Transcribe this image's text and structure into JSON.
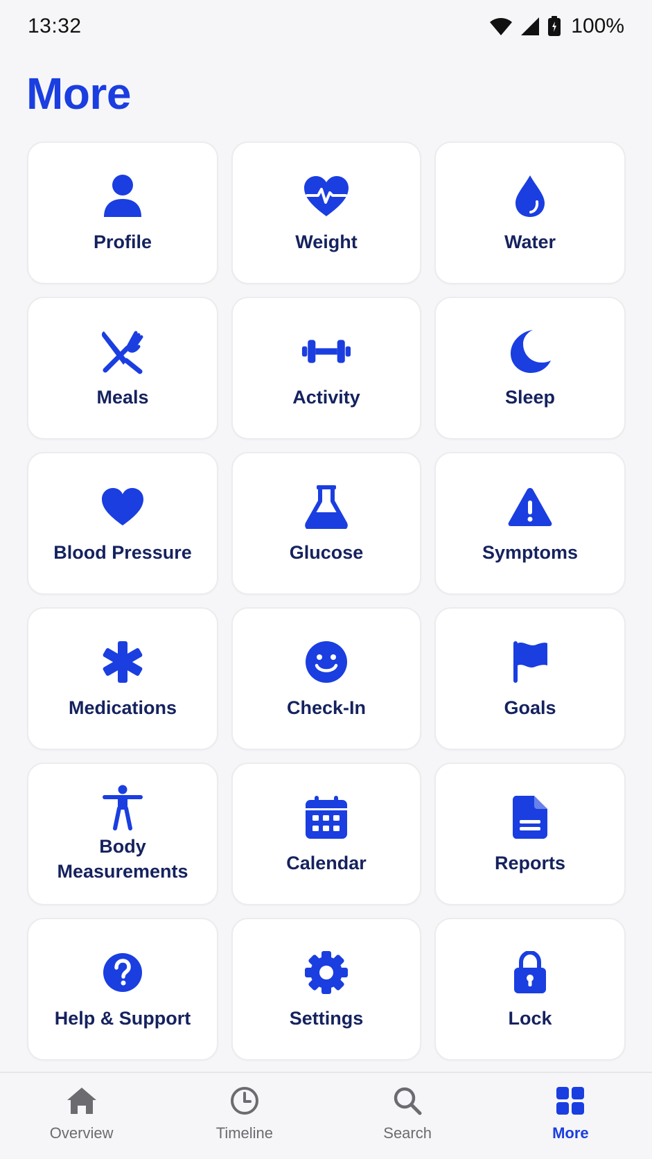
{
  "status_bar": {
    "time": "13:32",
    "battery": "100%"
  },
  "page": {
    "title": "More"
  },
  "accent_color": "#1a3ee0",
  "label_color": "#15225e",
  "tiles": [
    {
      "label": "Profile",
      "icon": "person-icon"
    },
    {
      "label": "Weight",
      "icon": "heart-pulse-icon"
    },
    {
      "label": "Water",
      "icon": "water-drop-icon"
    },
    {
      "label": "Meals",
      "icon": "fork-knife-icon"
    },
    {
      "label": "Activity",
      "icon": "dumbbell-icon"
    },
    {
      "label": "Sleep",
      "icon": "moon-icon"
    },
    {
      "label": "Blood Pressure",
      "icon": "heart-icon"
    },
    {
      "label": "Glucose",
      "icon": "flask-icon"
    },
    {
      "label": "Symptoms",
      "icon": "warning-icon"
    },
    {
      "label": "Medications",
      "icon": "asterisk-icon"
    },
    {
      "label": "Check-In",
      "icon": "smiley-icon"
    },
    {
      "label": "Goals",
      "icon": "flag-icon"
    },
    {
      "label": "Body\nMeasurements",
      "icon": "body-icon"
    },
    {
      "label": "Calendar",
      "icon": "calendar-icon"
    },
    {
      "label": "Reports",
      "icon": "document-icon"
    },
    {
      "label": "Help & Support",
      "icon": "help-icon"
    },
    {
      "label": "Settings",
      "icon": "gear-icon"
    },
    {
      "label": "Lock",
      "icon": "lock-icon"
    }
  ],
  "tab_bar": {
    "tabs": [
      {
        "label": "Overview",
        "icon": "home-icon",
        "active": false
      },
      {
        "label": "Timeline",
        "icon": "clock-icon",
        "active": false
      },
      {
        "label": "Search",
        "icon": "search-icon",
        "active": false
      },
      {
        "label": "More",
        "icon": "grid-icon",
        "active": true
      }
    ]
  }
}
